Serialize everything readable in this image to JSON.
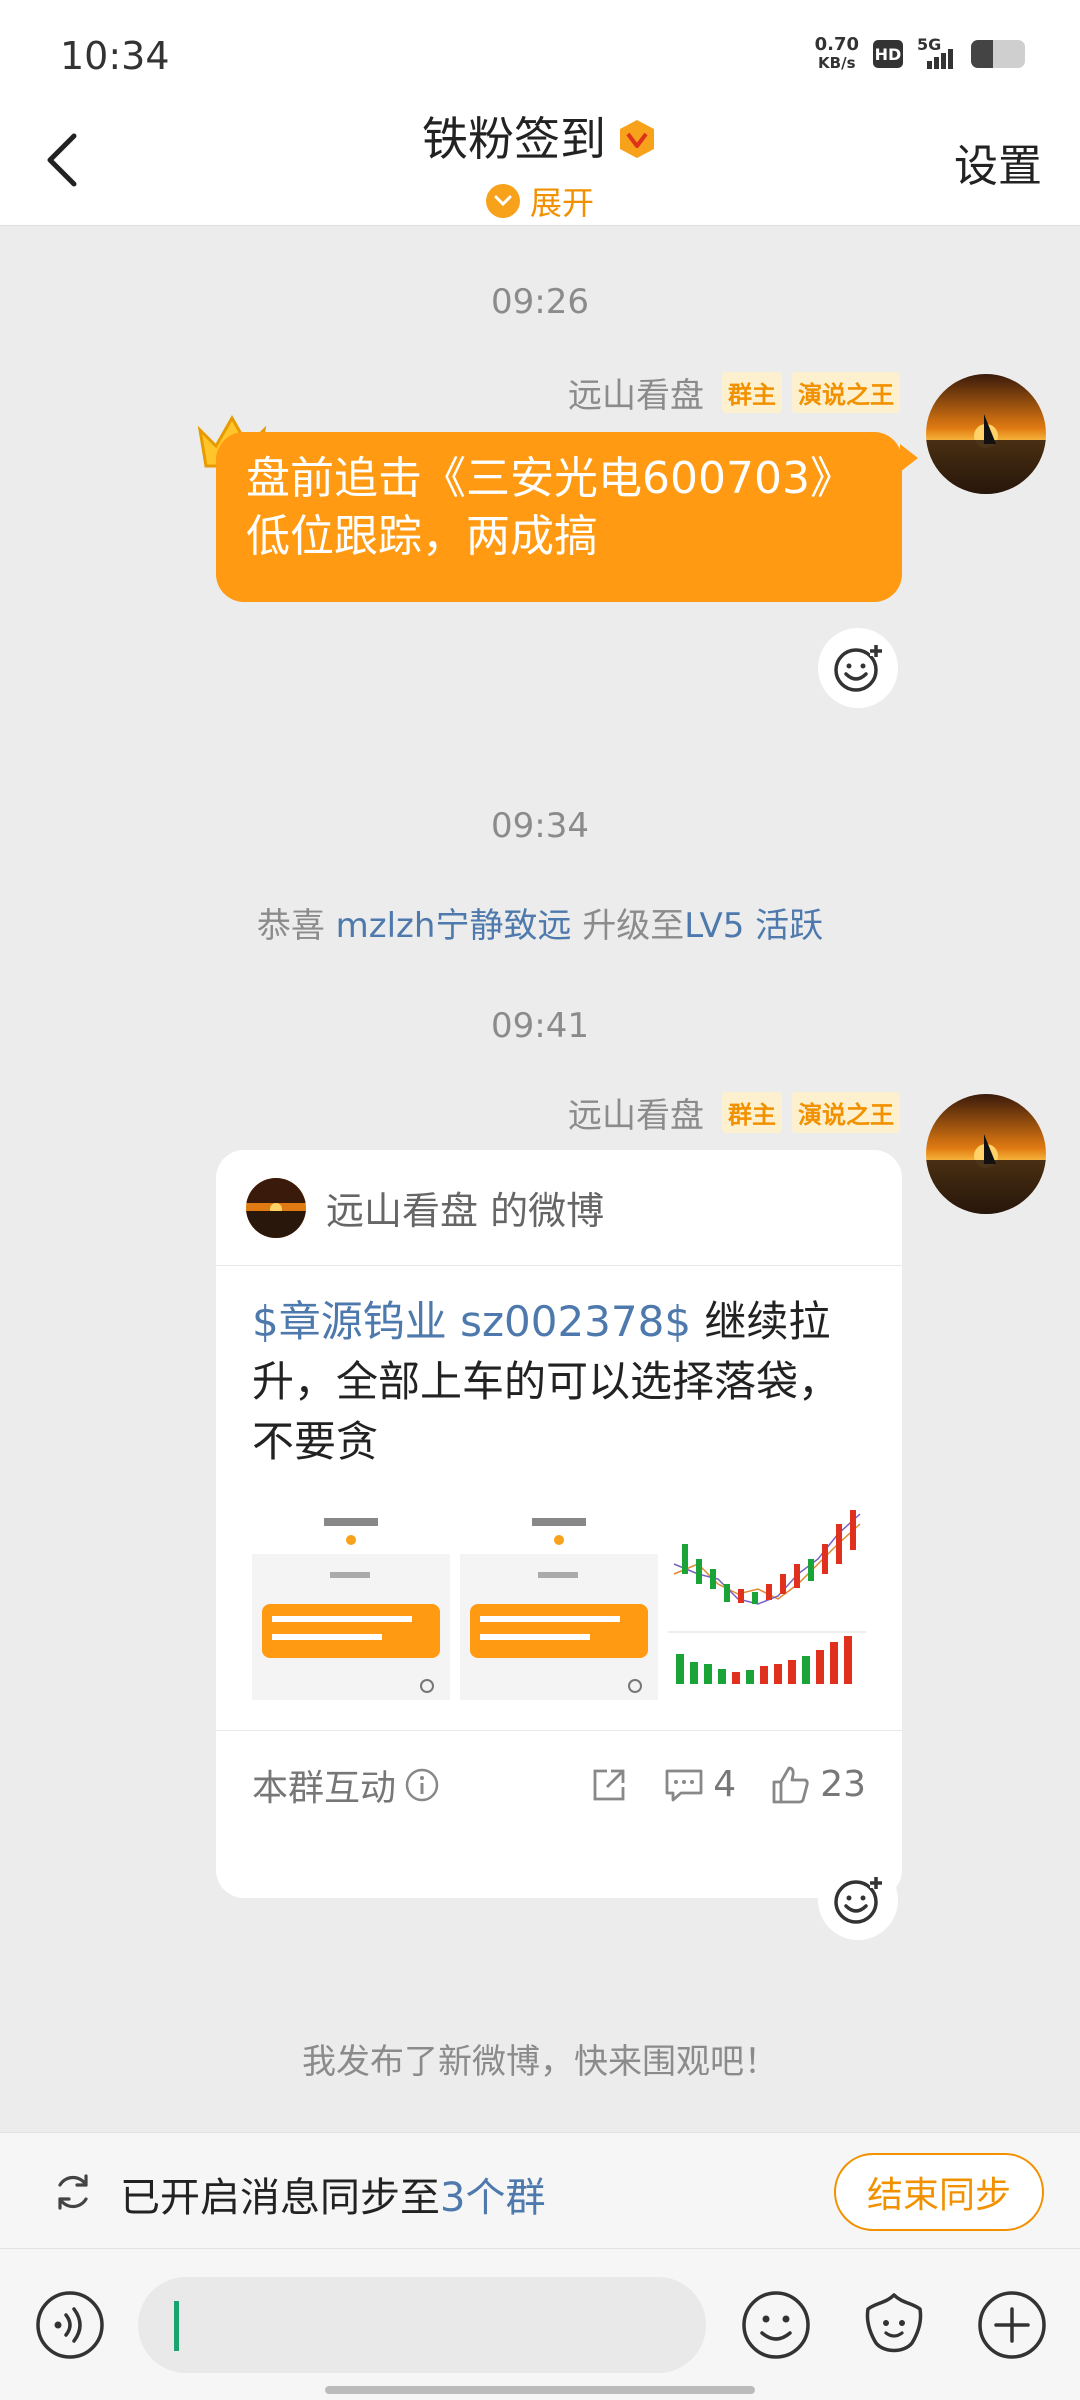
{
  "status_bar": {
    "time": "10:34",
    "net_speed_value": "0.70",
    "net_speed_unit": "KB/s",
    "hd_label": "HD",
    "network_label": "5G",
    "battery_level": 0.4
  },
  "header": {
    "title": "铁粉签到",
    "expand_label": "展开",
    "settings_label": "设置"
  },
  "chat": {
    "messages": [
      {
        "time": "09:26",
        "sender": "远山看盘",
        "tags": [
          "群主",
          "演说之王"
        ],
        "text_line1": "盘前追击《三安光电600703》",
        "text_line2": "低位跟踪，两成搞"
      },
      {
        "time": "09:34",
        "system_prefix": "恭喜",
        "system_user": "mzlzh宁静致远",
        "system_middle": "升级至",
        "system_level": "LV5 活跃"
      },
      {
        "time": "09:41",
        "sender": "远山看盘",
        "tags": [
          "群主",
          "演说之王"
        ],
        "card": {
          "author": "远山看盘 的微博",
          "stock_tag": "$章源钨业 sz002378$",
          "text_line1_rest": " 继续拉",
          "text_line2": "升，全部上车的可以选择落袋，",
          "text_line3": "不要贪",
          "interact_label": "本群互动",
          "comments": "4",
          "likes": "23"
        }
      }
    ],
    "footer_notice": "我发布了新微博，快来围观吧！"
  },
  "sync_bar": {
    "text": "已开启消息同步至",
    "group_count": "3个群",
    "button_label": "结束同步"
  },
  "colors": {
    "accent_orange": "#ff9a12",
    "link_blue": "#4d79ad",
    "tag_orange": "#f29100"
  }
}
